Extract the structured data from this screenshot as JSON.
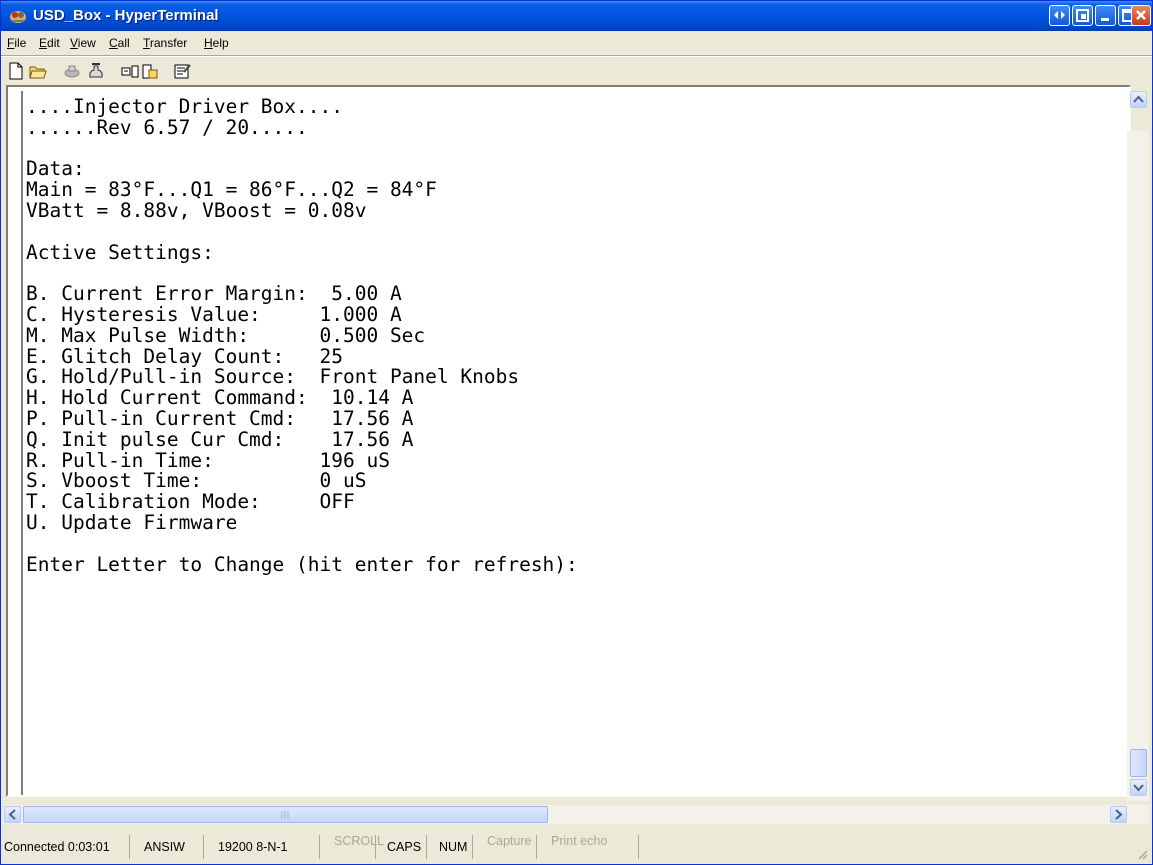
{
  "window": {
    "title": "USD_Box - HyperTerminal"
  },
  "menu": [
    "File",
    "Edit",
    "View",
    "Call",
    "Transfer",
    "Help"
  ],
  "toolbar": {
    "icons": [
      "new-icon",
      "open-icon",
      "disconnect-icon",
      "connect-icon",
      "send-icon",
      "receive-icon",
      "properties-icon"
    ]
  },
  "terminal": {
    "lines": [
      "....Injector Driver Box....",
      "......Rev 6.57 / 20.....",
      "",
      "Data:",
      "Main = 83°F...Q1 = 86°F...Q2 = 84°F",
      "VBatt = 8.88v, VBoost = 0.08v",
      "",
      "Active Settings:",
      "",
      "B. Current Error Margin:  5.00 A",
      "C. Hysteresis Value:     1.000 A",
      "M. Max Pulse Width:      0.500 Sec",
      "E. Glitch Delay Count:   25",
      "G. Hold/Pull-in Source:  Front Panel Knobs",
      "H. Hold Current Command:  10.14 A",
      "P. Pull-in Current Cmd:   17.56 A",
      "Q. Init pulse Cur Cmd:    17.56 A",
      "R. Pull-in Time:         196 uS",
      "S. Vboost Time:          0 uS",
      "T. Calibration Mode:     OFF",
      "U. Update Firmware",
      "",
      "Enter Letter to Change (hit enter for refresh):"
    ]
  },
  "status": {
    "connected": "Connected 0:03:01",
    "emulation": "ANSIW",
    "port": "19200 8-N-1",
    "scroll": "SCROLL",
    "caps": "CAPS",
    "num": "NUM",
    "capture": "Capture",
    "print_echo": "Print echo"
  },
  "colors": {
    "titlebar": "#0054e3",
    "close": "#c4391a",
    "chrome": "#ece9d8"
  }
}
